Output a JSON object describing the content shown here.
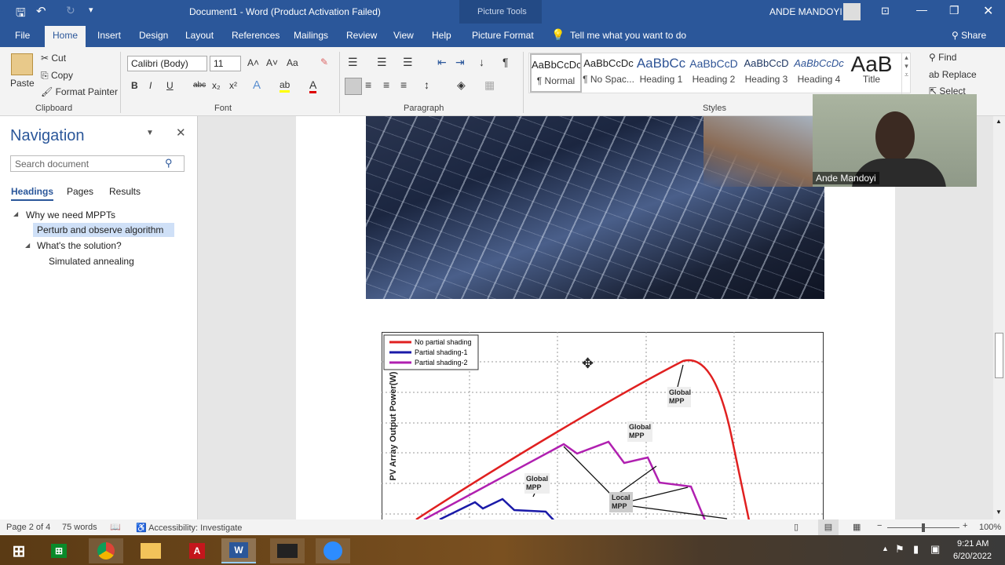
{
  "titlebar": {
    "title": "Document1  -  Word (Product Activation Failed)",
    "context_group": "Picture Tools",
    "user": "ANDE MANDOYI"
  },
  "tabs": [
    {
      "label": "File"
    },
    {
      "label": "Home",
      "active": true
    },
    {
      "label": "Insert"
    },
    {
      "label": "Design"
    },
    {
      "label": "Layout"
    },
    {
      "label": "References"
    },
    {
      "label": "Mailings"
    },
    {
      "label": "Review"
    },
    {
      "label": "View"
    },
    {
      "label": "Help"
    },
    {
      "label": "Picture Format"
    }
  ],
  "tell_me": "Tell me what you want to do",
  "share": "Share",
  "ribbon": {
    "clipboard": {
      "paste": "Paste",
      "cut": "Cut",
      "copy": "Copy",
      "format_painter": "Format Painter",
      "label": "Clipboard"
    },
    "font": {
      "name": "Calibri (Body)",
      "size": "11",
      "label": "Font",
      "bold": "B",
      "italic": "I",
      "underline": "U",
      "strike": "abc",
      "sub": "x₂",
      "sup": "x²",
      "grow": "A˄",
      "shrink": "A˅",
      "case": "Aa"
    },
    "paragraph": {
      "label": "Paragraph",
      "pilcrow": "¶"
    },
    "styles": {
      "label": "Styles",
      "items": [
        {
          "preview": "AaBbCcDc",
          "name": "¶ Normal"
        },
        {
          "preview": "AaBbCcDc",
          "name": "¶ No Spac..."
        },
        {
          "preview": "AaBbCc",
          "name": "Heading 1"
        },
        {
          "preview": "AaBbCcD",
          "name": "Heading 2"
        },
        {
          "preview": "AaBbCcD",
          "name": "Heading 3"
        },
        {
          "preview": "AaBbCcDc",
          "name": "Heading 4"
        },
        {
          "preview": "AaB",
          "name": "Title"
        }
      ]
    },
    "editing": {
      "find": "Find",
      "replace": "Replace",
      "select": "Select"
    }
  },
  "navigation": {
    "title": "Navigation",
    "search_placeholder": "Search document",
    "tabs": [
      "Headings",
      "Pages",
      "Results"
    ],
    "headings": [
      {
        "text": "Why we need MPPTs",
        "level": 1
      },
      {
        "text": "Perturb and observe algorithm",
        "level": 2,
        "selected": true
      },
      {
        "text": "What's the solution?",
        "level": 2
      },
      {
        "text": "Simulated annealing",
        "level": 3
      }
    ]
  },
  "figure": {
    "ylabel": "PV Array Output Power(W)",
    "legend": [
      {
        "name": "No partial shading",
        "color": "#e02020"
      },
      {
        "name": "Partial shading-1",
        "color": "#1a1aa8"
      },
      {
        "name": "Partial shading-2",
        "color": "#b020b0"
      }
    ],
    "annotations": [
      {
        "line1": "Global",
        "line2": "MPP"
      },
      {
        "line1": "Global",
        "line2": "MPP"
      },
      {
        "line1": "Global",
        "line2": "MPP"
      },
      {
        "line1": "Local",
        "line2": "MPP"
      }
    ]
  },
  "webcam": {
    "name": "Ande Mandoyi"
  },
  "status": {
    "page": "Page 2 of 4",
    "words": "75 words",
    "accessibility": "Accessibility: Investigate",
    "zoom": "100%"
  },
  "taskbar": {
    "time": "9:21 AM",
    "date": "6/20/2022"
  },
  "colors": {
    "accent": "#2b579a"
  }
}
